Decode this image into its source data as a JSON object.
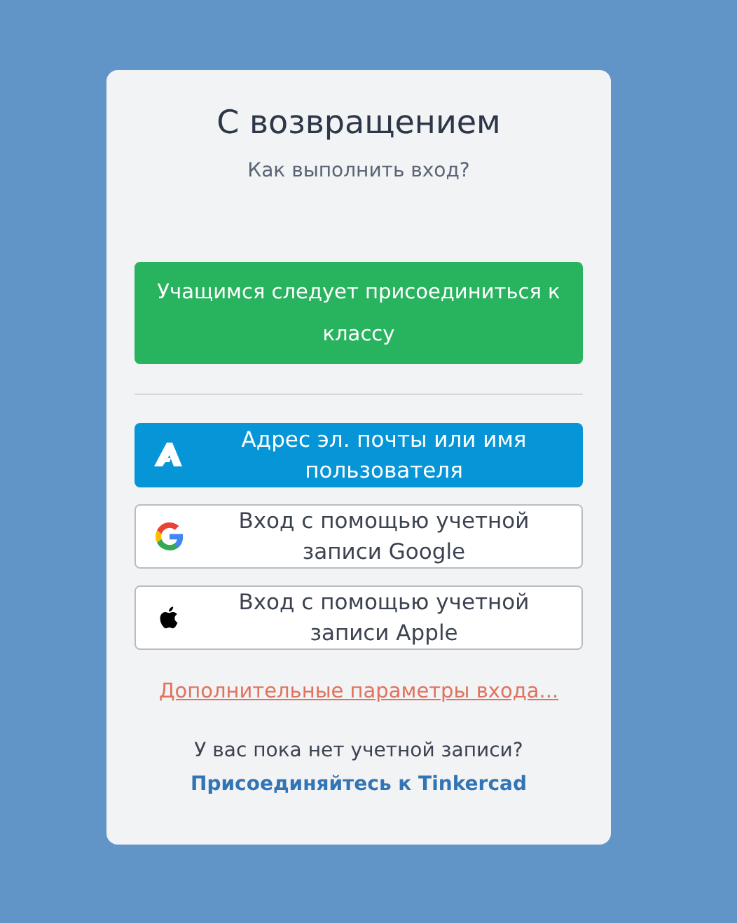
{
  "card": {
    "title": "С возвращением",
    "subtitle": "Как выполнить вход?",
    "student_button": "Учащимся следует присоединиться к классу",
    "sign_in_options": [
      {
        "kind": "autodesk",
        "label": "Адрес эл. почты или имя пользователя"
      },
      {
        "kind": "google",
        "label": "Вход с помощью учетной записи Google"
      },
      {
        "kind": "apple",
        "label": "Вход с помощью учетной записи Apple"
      }
    ],
    "more_options_link": "Дополнительные параметры входа...",
    "no_account_text": "У вас пока нет учетной записи?",
    "join_link": "Присоединяйтесь к Tinkercad"
  }
}
